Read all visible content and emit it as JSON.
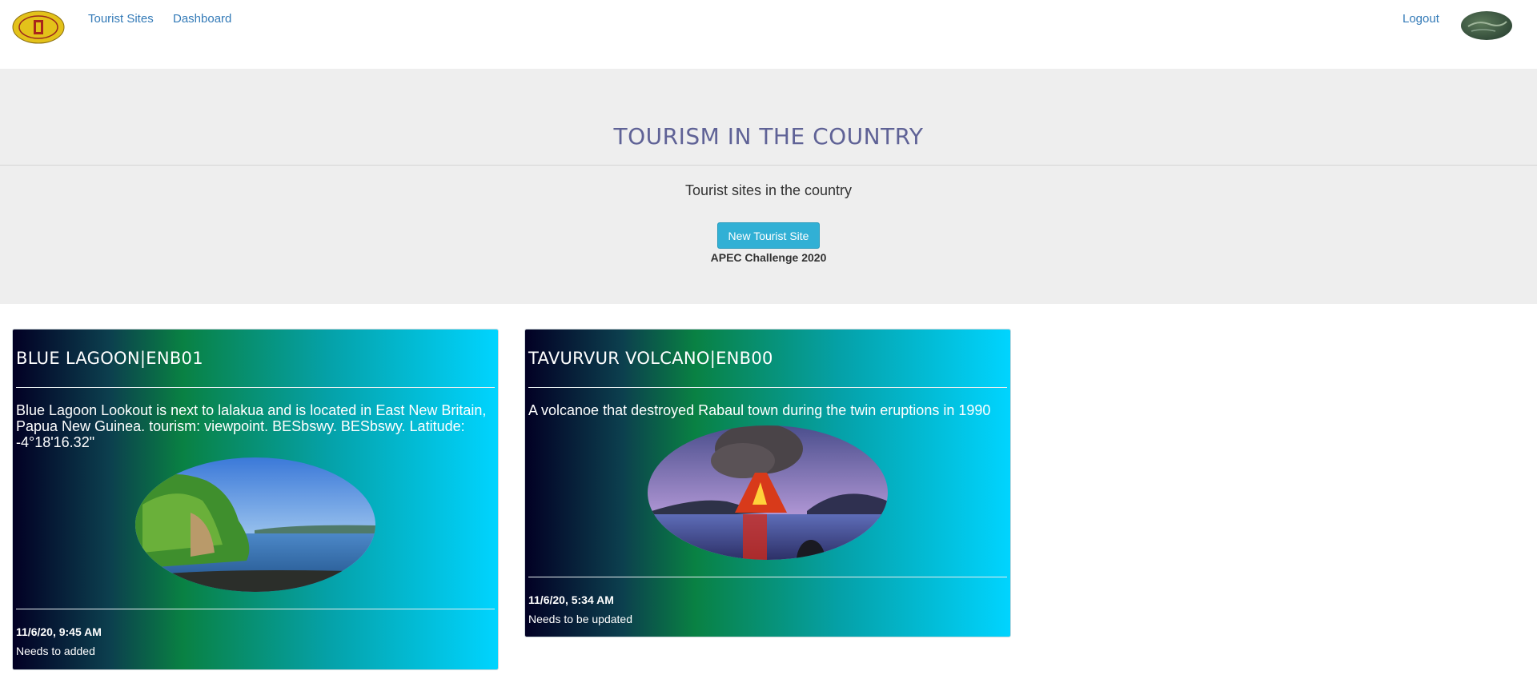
{
  "nav": {
    "links": [
      "Tourist Sites",
      "Dashboard"
    ],
    "logout": "Logout"
  },
  "header": {
    "title": "TOURISM IN THE COUNTRY",
    "subtitle": "Tourist sites in the country",
    "new_button": "New Tourist Site",
    "tagline": "APEC Challenge 2020"
  },
  "sites": [
    {
      "title": "BLUE LAGOON|ENB01",
      "description": "Blue Lagoon Lookout is next to lalakua and is located in East New Britain, Papua New Guinea. tourism: viewpoint. BESbswy. BESbswy. Latitude: -4°18'16.32\"",
      "date": "11/6/20, 9:45 AM",
      "status": "Needs to added"
    },
    {
      "title": "TAVURVUR VOLCANO|ENB00",
      "description": "A volcanoe that destroyed Rabaul town during the twin eruptions in 1990",
      "date": "11/6/20, 5:34 AM",
      "status": "Needs to be updated"
    }
  ],
  "colors": {
    "link": "#337ab7",
    "title": "#5f6296",
    "button": "#31b0d5",
    "jumbotron": "#eeeeee"
  }
}
